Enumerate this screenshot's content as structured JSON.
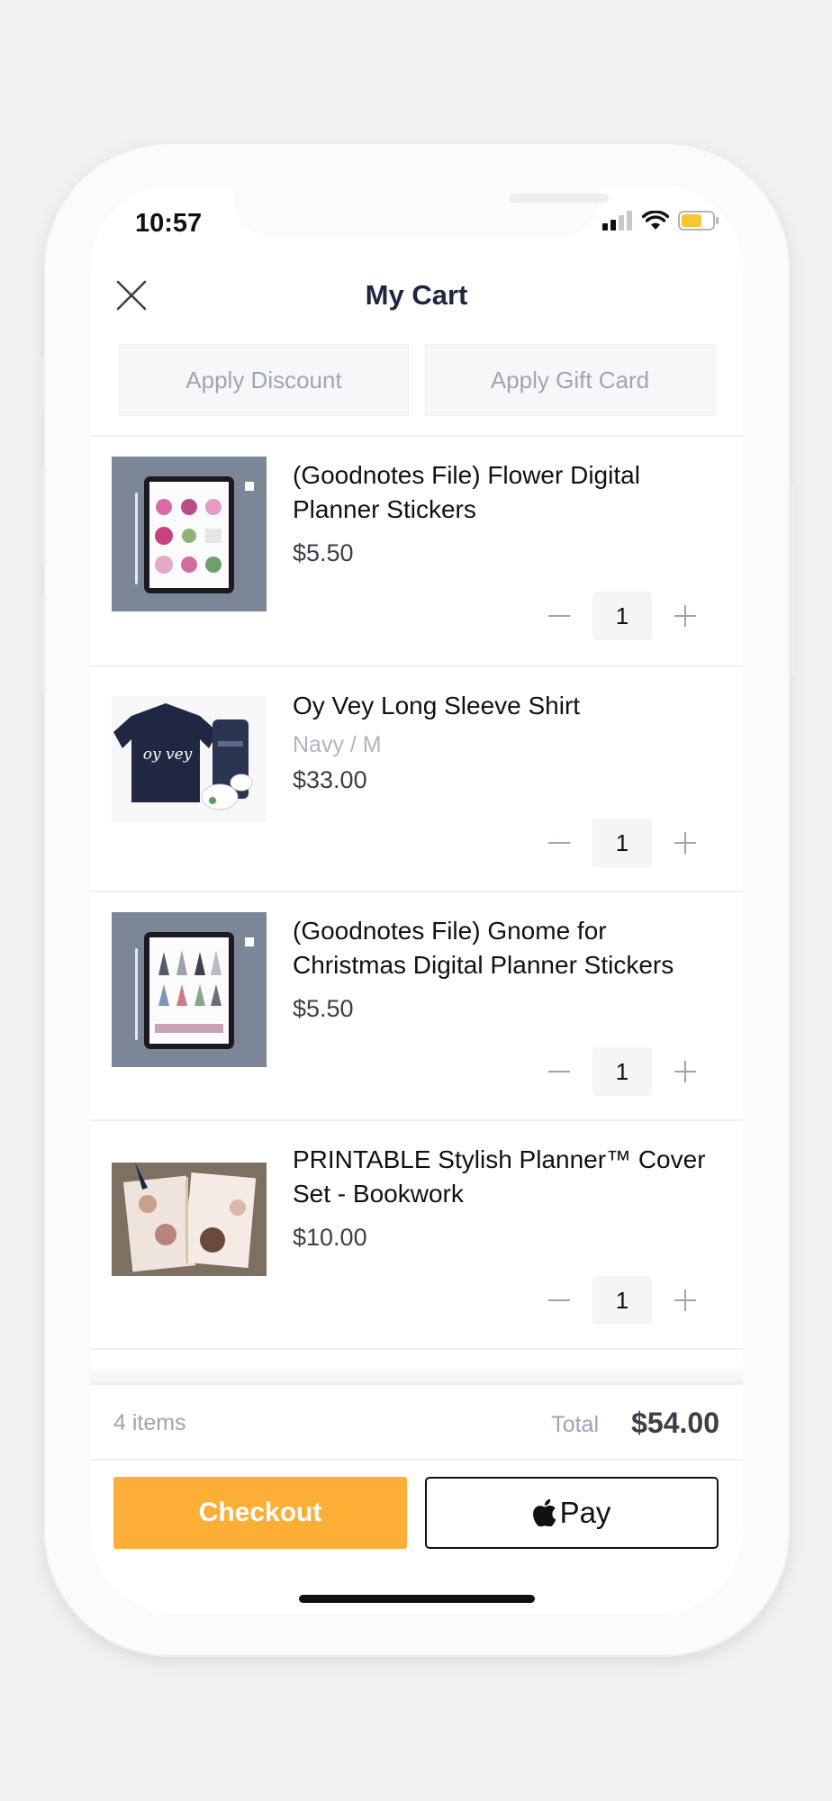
{
  "status_bar": {
    "time": "10:57"
  },
  "header": {
    "title": "My Cart",
    "apply_discount": "Apply Discount",
    "apply_gift_card": "Apply Gift Card"
  },
  "items": [
    {
      "name": "(Goodnotes File) Flower Digital Planner Stickers",
      "variant": "",
      "price": "$5.50",
      "qty": "1"
    },
    {
      "name": "Oy Vey Long Sleeve Shirt",
      "variant": "Navy / M",
      "price": "$33.00",
      "qty": "1",
      "shirt_text": "oy vey"
    },
    {
      "name": "(Goodnotes File) Gnome for Christmas Digital Planner Stickers",
      "variant": "",
      "price": "$5.50",
      "qty": "1"
    },
    {
      "name": "PRINTABLE Stylish Planner™ Cover Set - Bookwork",
      "variant": "",
      "price": "$10.00",
      "qty": "1"
    }
  ],
  "footer": {
    "items_count": "4 items",
    "total_label": "Total",
    "total_value": "$54.00",
    "checkout_label": "Checkout",
    "applepay_label": "Pay"
  },
  "colors": {
    "accent": "#fdae37",
    "title": "#1d2540",
    "muted": "#9fa4b4"
  }
}
